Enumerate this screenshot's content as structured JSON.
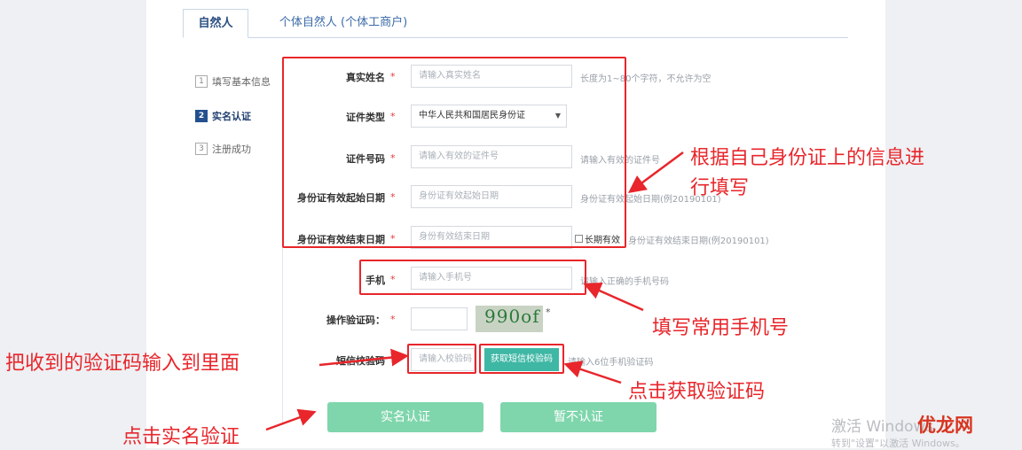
{
  "tabs": [
    "自然人",
    "个体自然人 (个体工商户)"
  ],
  "steps": [
    {
      "num": "1",
      "label": "填写基本信息"
    },
    {
      "num": "2",
      "label": "实名认证"
    },
    {
      "num": "3",
      "label": "注册成功"
    }
  ],
  "form": {
    "real_name": {
      "label": "真实姓名",
      "req": "*",
      "placeholder": "请输入真实姓名",
      "hint": "长度为1~80个字符，不允许为空"
    },
    "id_type": {
      "label": "证件类型",
      "req": "*",
      "value": "中华人民共和国居民身份证",
      "caret": "▼"
    },
    "id_number": {
      "label": "证件号码",
      "req": "*",
      "placeholder": "请输入有效的证件号",
      "hint": "请输入有效的证件号"
    },
    "valid_start": {
      "label": "身份证有效起始日期",
      "req": "*",
      "placeholder": "身份证有效起始日期",
      "hint": "身份证有效起始日期(例20190101)"
    },
    "valid_end": {
      "label": "身份证有效结束日期",
      "req": "*",
      "placeholder": "身份有效结束日期",
      "longterm": "长期有效",
      "hint": "身份证有效结束日期(例20190101)"
    },
    "phone": {
      "label": "手机",
      "req": "*",
      "placeholder": "请输入手机号",
      "hint": "请输入正确的手机号码"
    },
    "captcha": {
      "label": "操作验证码：",
      "req": "*",
      "image_text": "990of",
      "star": "*"
    },
    "sms": {
      "label": "短信校验码",
      "placeholder": "请输入校验码",
      "button": "获取短信校验码",
      "hint": "请输入6位手机验证码"
    }
  },
  "buttons": {
    "verify": "实名认证",
    "skip": "暂不认证"
  },
  "annotations": {
    "id_info": [
      "根据自己身份证上的信息进",
      "行填写"
    ],
    "phone": "填写常用手机号",
    "sms_input": "把收到的验证码输入到里面",
    "get_code": "点击获取验证码",
    "verify": "点击实名验证"
  },
  "watermark": {
    "line1": "激活 Windows",
    "line2": "转到\"设置\"以激活 Windows。",
    "logo": "优龙网"
  },
  "colors": {
    "accent_red": "#e8262b",
    "button_green": "#7fd6ac",
    "sms_teal": "#3fb7a5",
    "tab_blue": "#2b4f82"
  }
}
